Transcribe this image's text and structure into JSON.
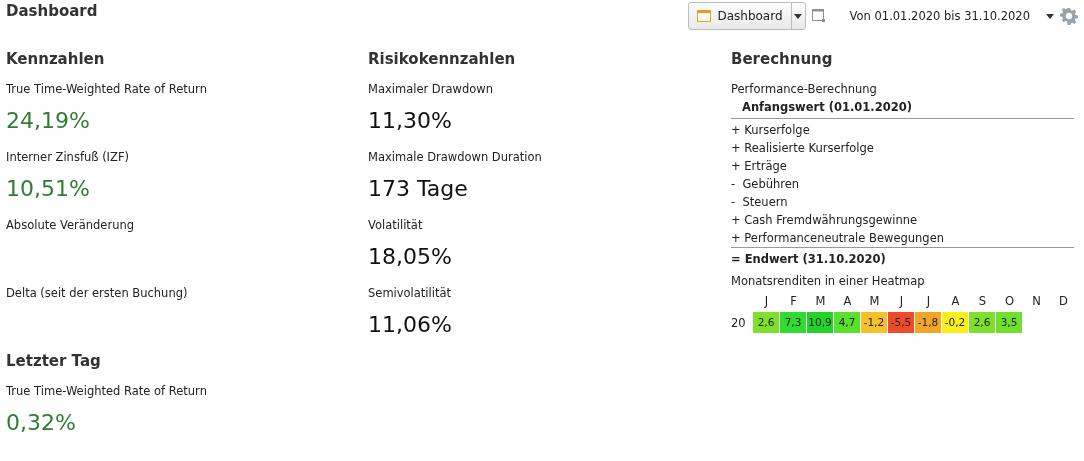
{
  "title": "Dashboard",
  "toolbar": {
    "view_button": "Dashboard",
    "period": "Von 01.01.2020 bis 31.10.2020"
  },
  "columns": [
    {
      "heading": "Kennzahlen",
      "metrics": [
        {
          "label": "True Time-Weighted Rate of Return",
          "value": "24,19%",
          "color": "#2e7d32"
        },
        {
          "label": "Interner Zinsfuß (IZF)",
          "value": "10,51%",
          "color": "#2e7d32"
        },
        {
          "label": "Absolute Veränderung"
        },
        {
          "label": "Delta (seit der ersten Buchung)"
        }
      ]
    },
    {
      "heading": "Risikokennzahlen",
      "metrics": [
        {
          "label": "Maximaler Drawdown",
          "value": "11,30%",
          "color": "#111111"
        },
        {
          "label": "Maximale Drawdown Duration",
          "value": "173 Tage",
          "color": "#111111"
        },
        {
          "label": "Volatilität",
          "value": "18,05%",
          "color": "#111111"
        },
        {
          "label": "Semivolatilität",
          "value": "11,06%",
          "color": "#111111"
        }
      ]
    }
  ],
  "last_day": {
    "heading": "Letzter Tag",
    "metrics": [
      {
        "label": "True Time-Weighted Rate of Return",
        "value": "0,32%",
        "color": "#2e7d32"
      }
    ]
  },
  "calculation": {
    "heading": "Berechnung",
    "subtitle": "Performance-Berechnung",
    "start": "Anfangswert (01.01.2020)",
    "items": [
      "+ Kurserfolge",
      "+ Realisierte Kurserfolge",
      "+ Erträge",
      "-  Gebühren",
      "-  Steuern",
      "+ Cash Fremdwährungsgewinne",
      "+ Performanceneutrale Bewegungen"
    ],
    "end": "= Endwert (31.10.2020)"
  },
  "heatmap": {
    "title": "Monatsrenditen in einer Heatmap",
    "months": [
      "J",
      "F",
      "M",
      "A",
      "M",
      "J",
      "J",
      "A",
      "S",
      "O",
      "N",
      "D"
    ],
    "rows": [
      {
        "year": "20",
        "cells": [
          {
            "value": "2,6",
            "color": "#7ee02a"
          },
          {
            "value": "7,3",
            "color": "#2fdc2f"
          },
          {
            "value": "10,9",
            "color": "#22d42a"
          },
          {
            "value": "4,7",
            "color": "#58e02c"
          },
          {
            "value": "-1,2",
            "color": "#f5c02a"
          },
          {
            "value": "-5,5",
            "color": "#ee4b2b"
          },
          {
            "value": "-1,8",
            "color": "#f3a528"
          },
          {
            "value": "-0,2",
            "color": "#f7f01e"
          },
          {
            "value": "2,6",
            "color": "#7ee02a"
          },
          {
            "value": "3,5",
            "color": "#6fe02b"
          }
        ]
      }
    ]
  }
}
